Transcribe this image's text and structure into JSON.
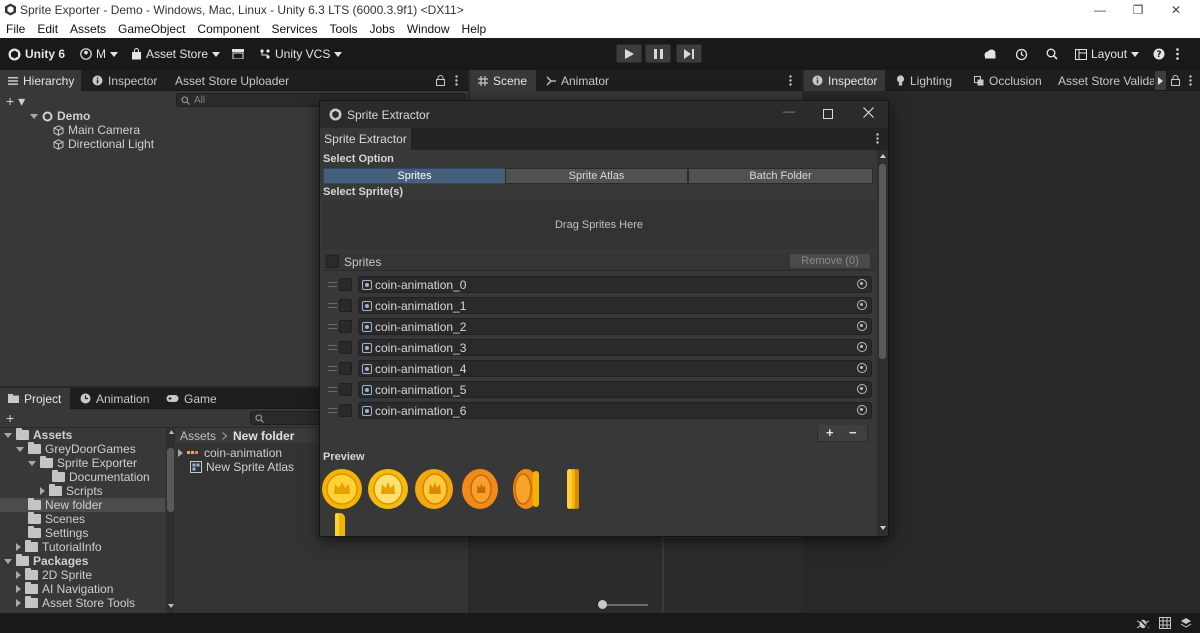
{
  "window": {
    "title": "Sprite Exporter - Demo - Windows, Mac, Linux - Unity 6.3 LTS (6000.3.9f1) <DX11>",
    "minimize": "—",
    "maximize": "❐",
    "close": "✕"
  },
  "menu": [
    "File",
    "Edit",
    "Assets",
    "GameObject",
    "Component",
    "Services",
    "Tools",
    "Jobs",
    "Window",
    "Help"
  ],
  "toolbar": {
    "unity_label": "Unity 6",
    "account_label": "M",
    "asset_store_label": "Asset Store",
    "vcs_label": "Unity VCS",
    "layout_label": "Layout"
  },
  "hierarchy": {
    "tabs": [
      "Hierarchy",
      "Inspector",
      "Asset Store Uploader"
    ],
    "search_placeholder": "All",
    "scene": "Demo",
    "objects": [
      "Main Camera",
      "Directional Light"
    ]
  },
  "scene_tabs": [
    "Scene",
    "Animator"
  ],
  "right_tabs": [
    "Inspector",
    "Lighting",
    "Occlusion",
    "Asset Store Validat"
  ],
  "project": {
    "tabs": [
      "Project",
      "Animation",
      "Game"
    ],
    "tree": [
      {
        "label": "Assets",
        "depth": 0,
        "bold": true
      },
      {
        "label": "GreyDoorGames",
        "depth": 1
      },
      {
        "label": "Sprite Exporter",
        "depth": 2
      },
      {
        "label": "Documentation",
        "depth": 3
      },
      {
        "label": "Scripts",
        "depth": 3
      },
      {
        "label": "New folder",
        "depth": 1
      },
      {
        "label": "Scenes",
        "depth": 1
      },
      {
        "label": "Settings",
        "depth": 1
      },
      {
        "label": "TutorialInfo",
        "depth": 1
      },
      {
        "label": "Packages",
        "depth": 0,
        "bold": true
      },
      {
        "label": "2D Sprite",
        "depth": 1
      },
      {
        "label": "AI Navigation",
        "depth": 1
      },
      {
        "label": "Asset Store Tools",
        "depth": 1
      }
    ],
    "breadcrumb": [
      "Assets",
      "New folder"
    ],
    "files": [
      "coin-animation",
      "New Sprite Atlas"
    ]
  },
  "modal": {
    "title": "Sprite Extractor",
    "tab": "Sprite Extractor",
    "select_option_label": "Select Option",
    "options": [
      "Sprites",
      "Sprite Atlas",
      "Batch Folder"
    ],
    "selected_option": "Sprites",
    "select_sprites_label": "Select Sprite(s)",
    "drop_hint": "Drag Sprites Here",
    "list_header": "Sprites",
    "remove_label": "Remove (0)",
    "sprites": [
      "coin-animation_0",
      "coin-animation_1",
      "coin-animation_2",
      "coin-animation_3",
      "coin-animation_4",
      "coin-animation_5",
      "coin-animation_6"
    ],
    "add_label": "+",
    "minus_label": "−",
    "preview_label": "Preview",
    "coin_colors": {
      "gold": "#f5b400",
      "orange": "#f08a1a",
      "highlight": "#ffe680",
      "shadow": "#c96a00"
    }
  }
}
